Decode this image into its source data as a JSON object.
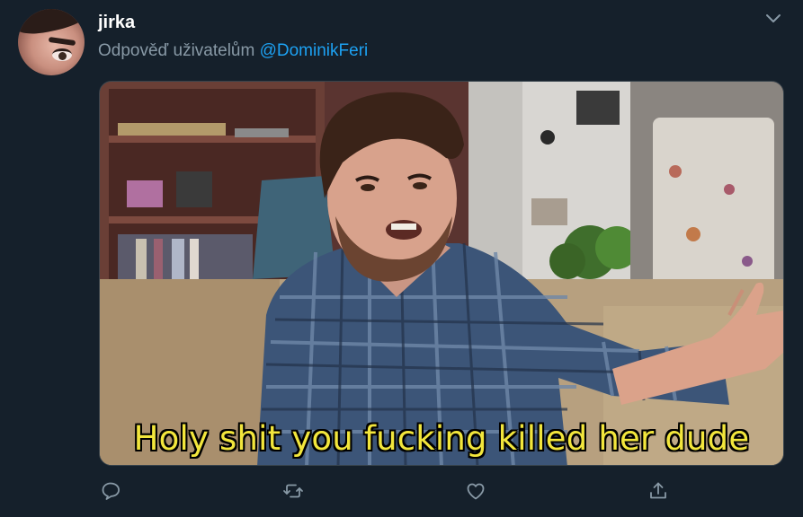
{
  "tweet": {
    "username": "jirka",
    "reply_prefix": "Odpověď uživatelům ",
    "reply_mention": "@DominikFeri",
    "caption": "Holy shit you fucking killed her dude"
  },
  "colors": {
    "background": "#15202b",
    "secondary_text": "#8899a6",
    "mention": "#1da1f2",
    "caption_text": "#f2e63c"
  },
  "icons": {
    "menu": "chevron-down-icon",
    "reply": "reply-icon",
    "retweet": "retweet-icon",
    "like": "heart-icon",
    "share": "share-icon"
  }
}
